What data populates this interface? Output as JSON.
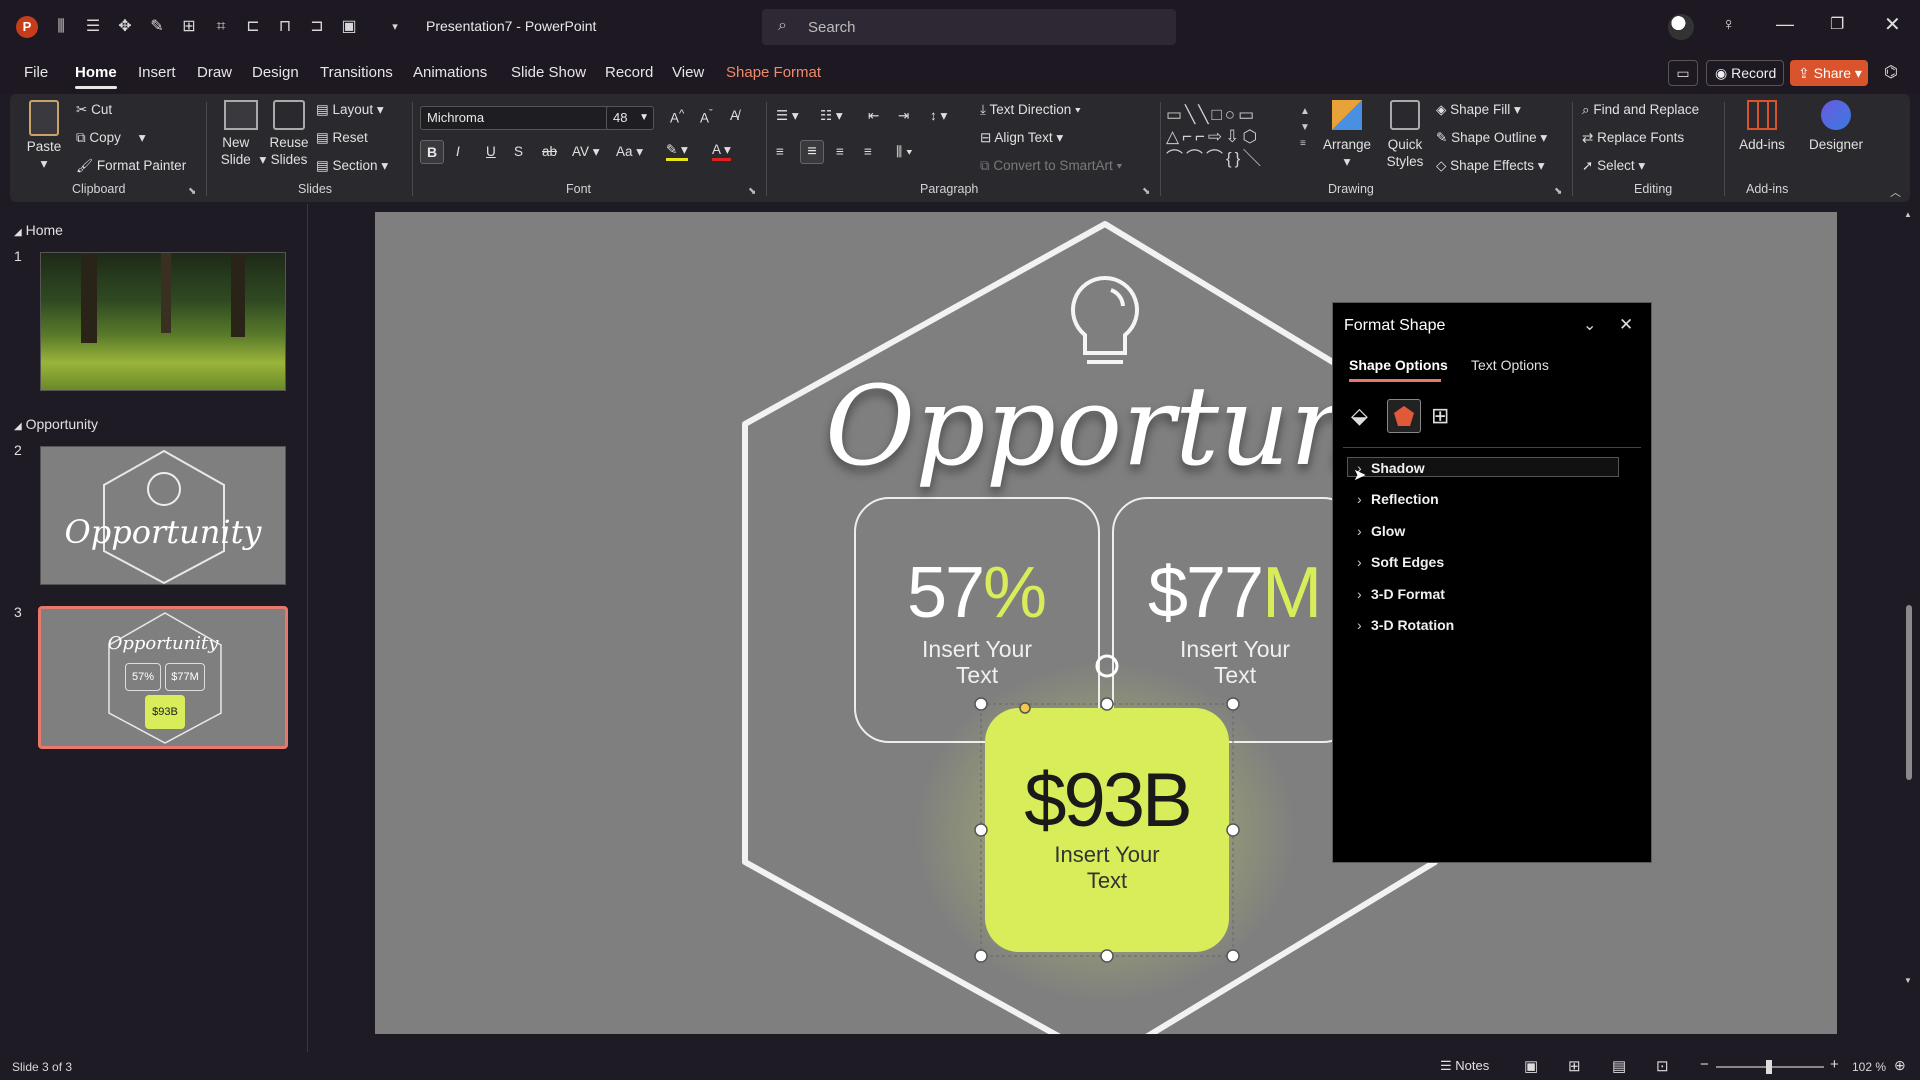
{
  "window": {
    "title": "Presentation7  -  PowerPoint",
    "search_placeholder": "Search"
  },
  "ribbon_tabs": [
    "File",
    "Home",
    "Insert",
    "Draw",
    "Design",
    "Transitions",
    "Animations",
    "Slide Show",
    "Record",
    "View",
    "Shape Format"
  ],
  "header_buttons": {
    "record": "Record",
    "share": "Share"
  },
  "clipboard": {
    "paste": "Paste",
    "cut": "Cut",
    "copy": "Copy",
    "format_painter": "Format Painter",
    "group": "Clipboard"
  },
  "slides_group": {
    "new_slide": "New Slide",
    "reuse_slides": "Reuse Slides",
    "layout": "Layout",
    "reset": "Reset",
    "section": "Section",
    "group": "Slides"
  },
  "font_group": {
    "font_name": "Michroma",
    "font_size": "48",
    "group": "Font"
  },
  "paragraph_group": {
    "text_direction": "Text Direction",
    "align_text": "Align Text",
    "convert_smartart": "Convert to SmartArt",
    "group": "Paragraph"
  },
  "drawing_group": {
    "arrange": "Arrange",
    "quick_styles": "Quick Styles",
    "shape_fill": "Shape Fill",
    "shape_outline": "Shape Outline",
    "shape_effects": "Shape Effects",
    "group": "Drawing"
  },
  "editing_group": {
    "find_replace": "Find and Replace",
    "replace_fonts": "Replace Fonts",
    "select": "Select",
    "group": "Editing"
  },
  "addins_group": {
    "addins": "Add-ins",
    "designer": "Designer",
    "group": "Add-ins"
  },
  "slide_panel": {
    "sections": [
      "Home",
      "Opportunity"
    ],
    "slide_numbers": [
      "1",
      "2",
      "3"
    ],
    "thumb2_title": "Opportunity",
    "thumb3": {
      "title": "Opportunity",
      "v1": "57%",
      "v2": "$77M",
      "v3": "$93B"
    }
  },
  "slide": {
    "title": "Opportunity",
    "card1": {
      "value": "57",
      "suffix": "%",
      "caption": "Insert Your Text"
    },
    "card2": {
      "value": "$77",
      "suffix": "M",
      "caption": "Insert Your Text"
    },
    "card3": {
      "value": "$93B",
      "caption": "Insert Your Text"
    },
    "accent": "#d9ec5a"
  },
  "format_shape": {
    "title": "Format Shape",
    "tabs": [
      "Shape Options",
      "Text Options"
    ],
    "items": [
      "Shadow",
      "Reflection",
      "Glow",
      "Soft Edges",
      "3-D Format",
      "3-D Rotation"
    ]
  },
  "status": {
    "slide_info": "Slide 3 of 3",
    "notes": "Notes",
    "zoom": "102 %"
  }
}
